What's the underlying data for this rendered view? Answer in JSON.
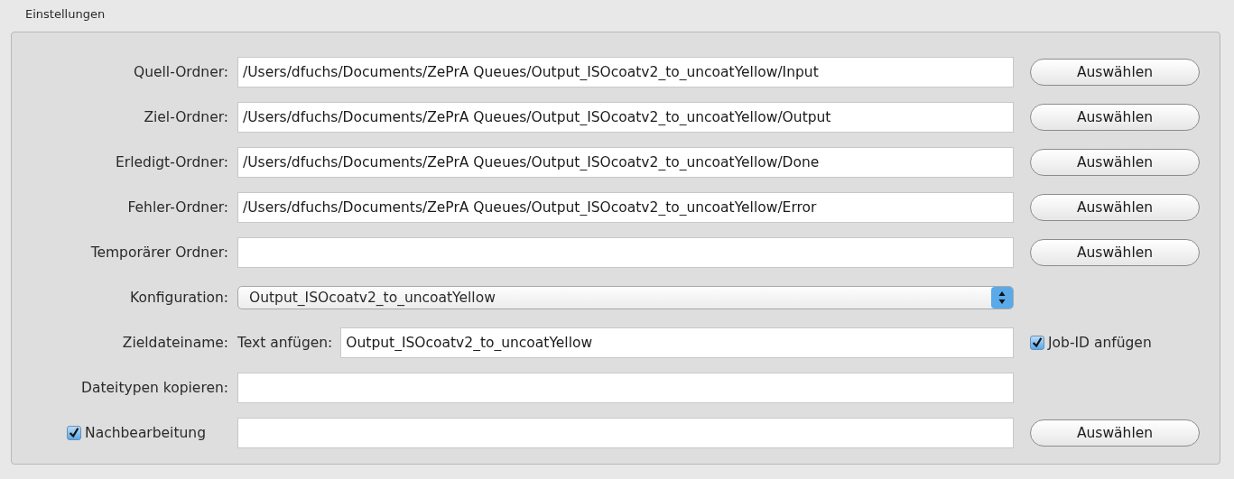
{
  "group": {
    "title": "Einstellungen"
  },
  "rows": [
    {
      "kind": "folder",
      "label": "Quell-Ordner:",
      "value": "/Users/dfuchs/Documents/ZePrA Queues/Output_ISOcoatv2_to_uncoatYellow/Input",
      "button": "Auswählen"
    },
    {
      "kind": "folder",
      "label": "Ziel-Ordner:",
      "value": "/Users/dfuchs/Documents/ZePrA Queues/Output_ISOcoatv2_to_uncoatYellow/Output",
      "button": "Auswählen"
    },
    {
      "kind": "folder",
      "label": "Erledigt-Ordner:",
      "value": "/Users/dfuchs/Documents/ZePrA Queues/Output_ISOcoatv2_to_uncoatYellow/Done",
      "button": "Auswählen"
    },
    {
      "kind": "folder",
      "label": "Fehler-Ordner:",
      "value": "/Users/dfuchs/Documents/ZePrA Queues/Output_ISOcoatv2_to_uncoatYellow/Error",
      "button": "Auswählen"
    },
    {
      "kind": "folder",
      "label": "Temporärer Ordner:",
      "button": "Auswählen"
    },
    {
      "kind": "select",
      "label": "Konfiguration:",
      "value": "Output_ISOcoatv2_to_uncoatYellow"
    },
    {
      "kind": "filename",
      "label": "Zieldateiname:",
      "sublabel": "Text anfügen:",
      "value": "Output_ISOcoatv2_to_uncoatYellow",
      "option": {
        "label": "Job-ID anfügen",
        "checked": true
      }
    },
    {
      "kind": "field",
      "label": "Dateitypen kopieren:"
    },
    {
      "kind": "toggle",
      "label": "Nachbearbeitung",
      "checked": true,
      "button": "Auswählen"
    }
  ]
}
